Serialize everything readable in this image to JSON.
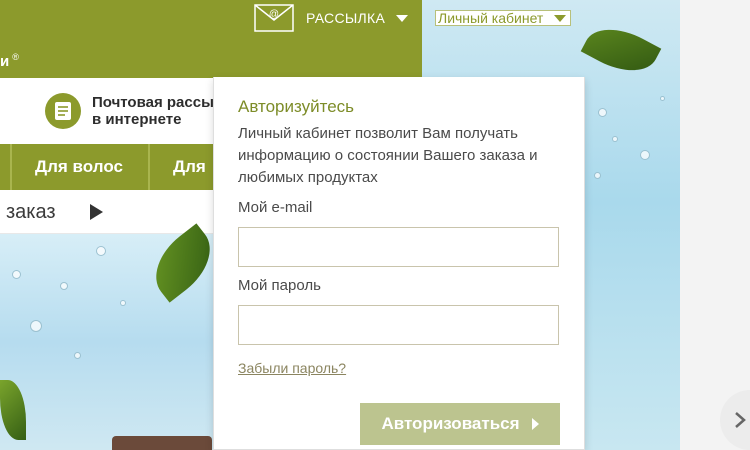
{
  "header": {
    "brand_tail": "и",
    "brand_mark": "®",
    "newsletter_label": "РАССЫЛКА",
    "cabinet_label": "Личный кабинет"
  },
  "promo": {
    "line1": "Почтовая рассы",
    "line2": "в интернете"
  },
  "nav": {
    "items": [
      {
        "label": "Для волос"
      },
      {
        "label": "Для"
      }
    ]
  },
  "order": {
    "label": "заказ"
  },
  "auth": {
    "title": "Авторизуйтесь",
    "description": "Личный кабинет позволит Вам получать информацию о состоянии Вашего заказа и любимых продуктах",
    "email_label": "Мой e-mail",
    "email_value": "",
    "password_label": "Мой пароль",
    "password_value": "",
    "forgot_link": "Забыли пароль?",
    "submit_label": "Авторизоваться"
  },
  "icons": {
    "mail": "mail-at-icon",
    "newsletter": "newsletter-icon",
    "next": "chevron-right-icon"
  },
  "colors": {
    "olive": "#8c9a2c",
    "button": "#bcc48f",
    "title": "#7d8c28"
  }
}
